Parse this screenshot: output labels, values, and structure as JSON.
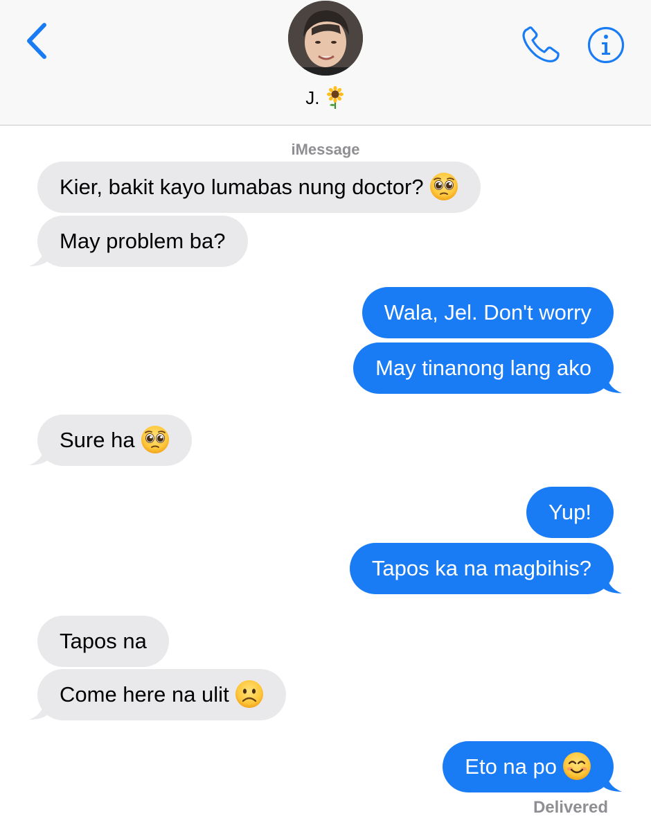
{
  "header": {
    "contact_name": "J.",
    "contact_emoji": "sunflower",
    "avatar_icon": "user-avatar",
    "back_icon": "chevron-left-icon",
    "phone_icon": "phone-icon",
    "info_icon": "info-icon"
  },
  "service_label": "iMessage",
  "messages": [
    {
      "direction": "incoming",
      "text": "Kier, bakit kayo lumabas nung doctor?",
      "emoji": "pleading-face"
    },
    {
      "direction": "incoming",
      "text": "May problem ba?",
      "emoji": ""
    },
    {
      "direction": "outgoing",
      "text": "Wala, Jel. Don't worry",
      "emoji": ""
    },
    {
      "direction": "outgoing",
      "text": "May tinanong lang ako",
      "emoji": ""
    },
    {
      "direction": "incoming",
      "text": "Sure ha",
      "emoji": "pleading-face"
    },
    {
      "direction": "outgoing",
      "text": "Yup!",
      "emoji": ""
    },
    {
      "direction": "outgoing",
      "text": "Tapos ka na magbihis?",
      "emoji": ""
    },
    {
      "direction": "incoming",
      "text": "Tapos na",
      "emoji": ""
    },
    {
      "direction": "incoming",
      "text": "Come here na ulit",
      "emoji": "frowning-face"
    },
    {
      "direction": "outgoing",
      "text": "Eto na po",
      "emoji": "smiling-face"
    }
  ],
  "delivery_status": "Delivered",
  "colors": {
    "accent": "#1a7cf5",
    "incoming_bubble": "#e9e9eb",
    "outgoing_bubble": "#1a7cf5",
    "header_bg": "#f8f8f8",
    "secondary_text": "#8e8e93"
  }
}
